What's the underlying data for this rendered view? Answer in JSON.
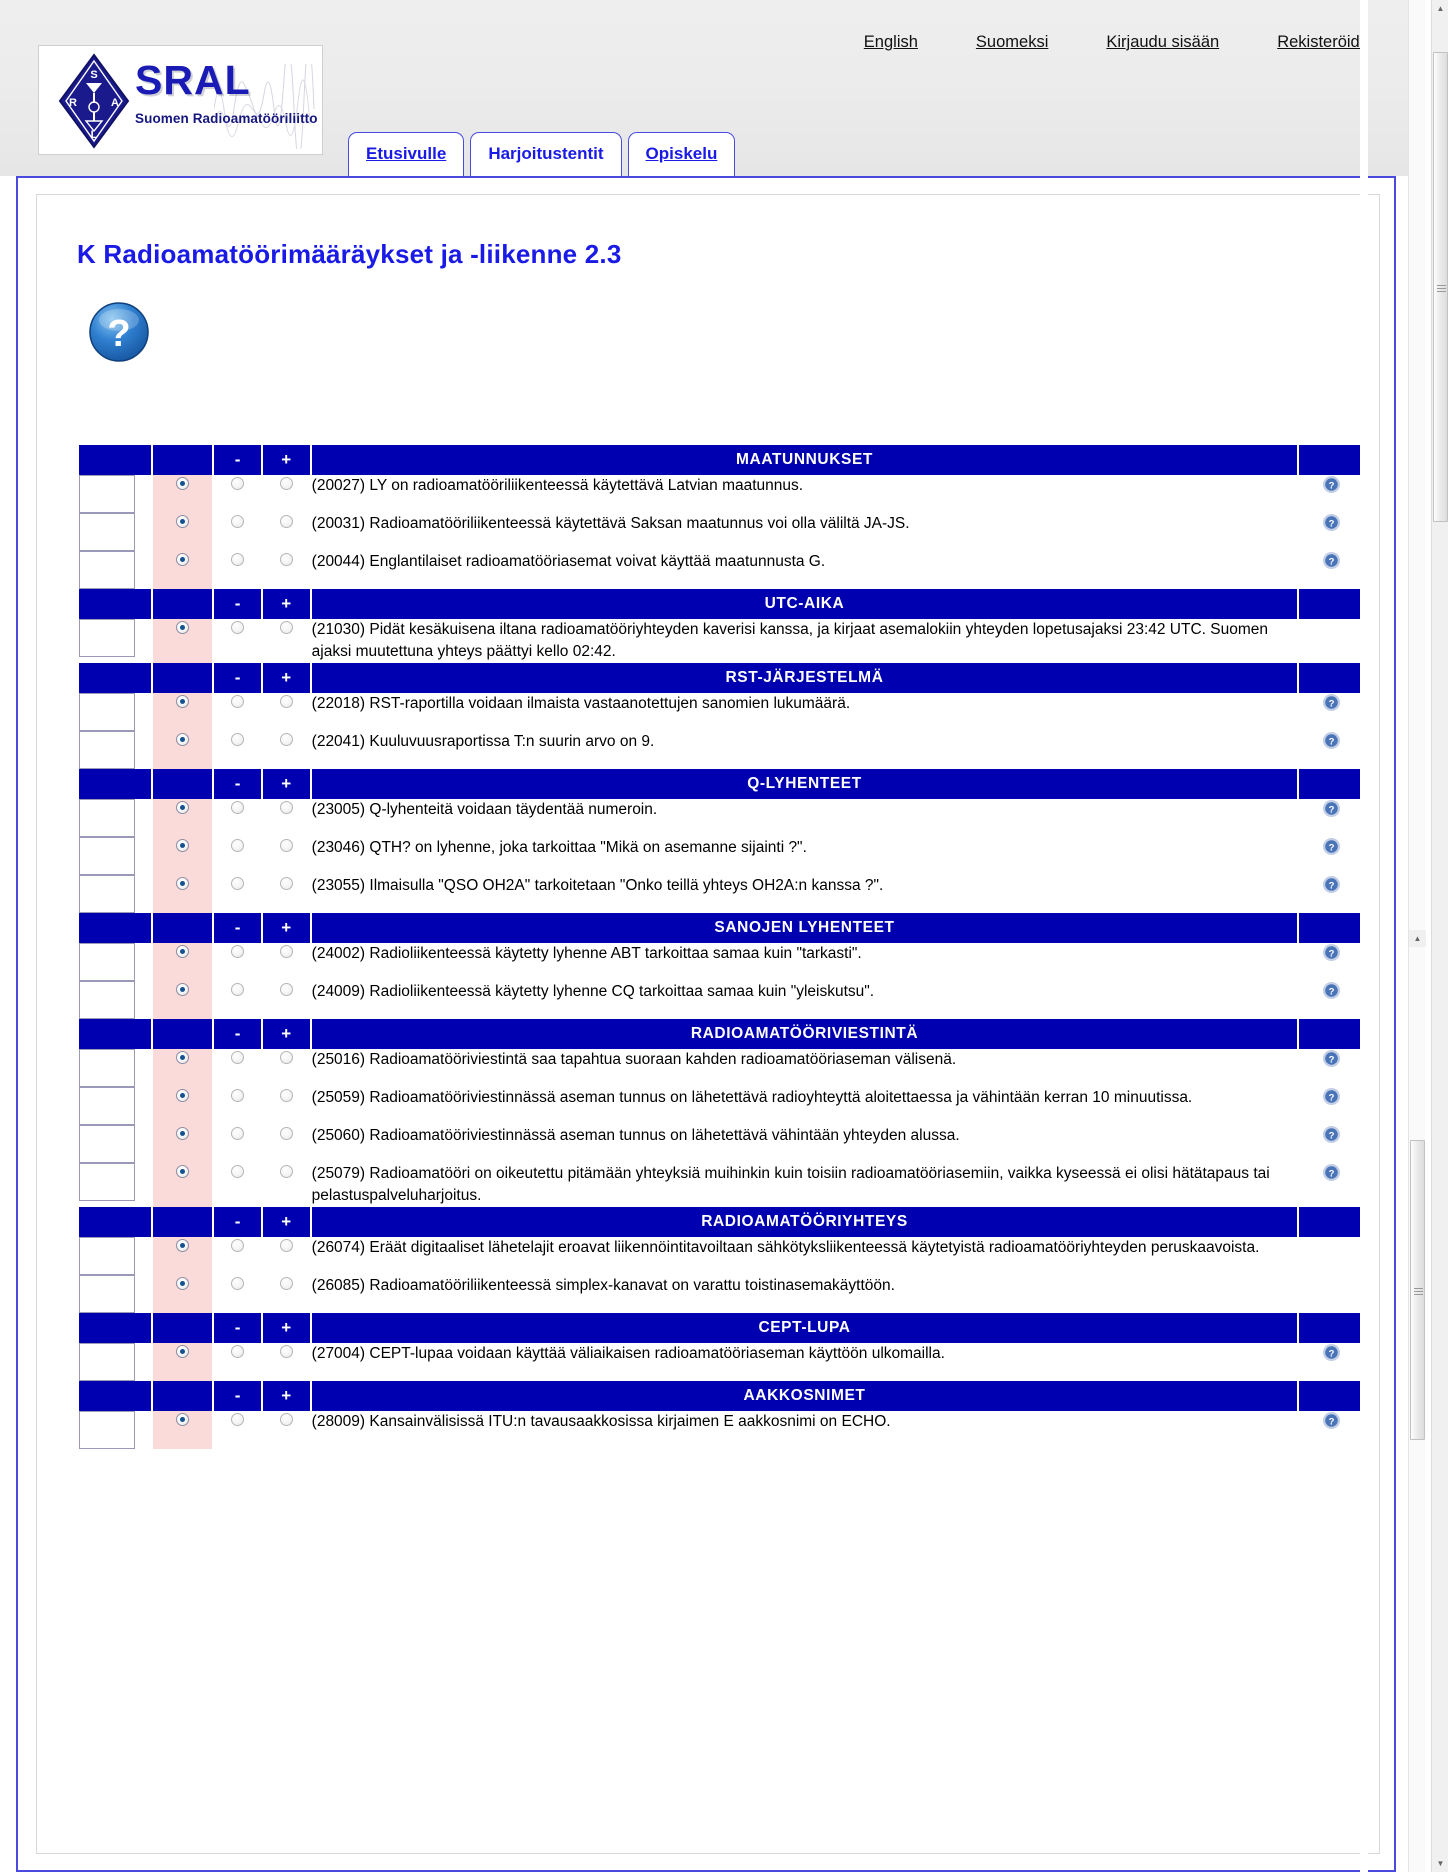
{
  "header": {
    "top_links": [
      {
        "label": "English",
        "name": "english-link"
      },
      {
        "label": "Suomeksi",
        "name": "suomeksi-link"
      },
      {
        "label": "Kirjaudu sisään",
        "name": "login-link"
      },
      {
        "label": "Rekisteröidy",
        "name": "register-link"
      }
    ],
    "logo": {
      "title": "SRAL",
      "subtitle": "Suomen Radioamatööriliitto ry",
      "diamond_letters": {
        "top": "S",
        "left": "R",
        "right": "A",
        "bottom": "L"
      }
    },
    "tabs": [
      {
        "label": "Etusivulle",
        "active": false
      },
      {
        "label": "Harjoitustentit",
        "active": true
      },
      {
        "label": "Opiskelu",
        "active": false
      }
    ]
  },
  "main": {
    "page_title": "K Radioamatöörimääräykset ja -liikenne 2.3",
    "help_icon": "question-mark-icon",
    "column_headers": {
      "minus": "-",
      "plus": "+"
    },
    "sections": [
      {
        "title": "MAATUNNUKSET",
        "questions": [
          {
            "text": "(20027) LY on radioamatööriliikenteessä käytettävä Latvian maatunnus.",
            "answer": "",
            "selected": 0,
            "help": true
          },
          {
            "text": "(20031) Radioamatööriliikenteessä käytettävä Saksan maatunnus voi olla väliltä JA-JS.",
            "answer": "",
            "selected": 0,
            "help": true
          },
          {
            "text": "(20044) Englantilaiset radioamatööriasemat voivat käyttää maatunnusta G.",
            "answer": "",
            "selected": 0,
            "help": true
          }
        ]
      },
      {
        "title": "UTC-AIKA",
        "questions": [
          {
            "text": "(21030) Pidät kesäkuisena iltana radioamatööriyhteyden kaverisi kanssa, ja kirjaat asemalokiin yhteyden lopetusajaksi 23:42 UTC. Suomen ajaksi muutettuna yhteys päättyi kello 02:42.",
            "answer": "",
            "selected": 0,
            "help": false
          }
        ]
      },
      {
        "title": "RST-JÄRJESTELMÄ",
        "questions": [
          {
            "text": "(22018) RST-raportilla voidaan ilmaista vastaanotettujen sanomien lukumäärä.",
            "answer": "",
            "selected": 0,
            "help": true
          },
          {
            "text": "(22041) Kuuluvuusraportissa T:n suurin arvo on 9.",
            "answer": "",
            "selected": 0,
            "help": true
          }
        ]
      },
      {
        "title": "Q-LYHENTEET",
        "questions": [
          {
            "text": "(23005) Q-lyhenteitä voidaan täydentää numeroin.",
            "answer": "",
            "selected": 0,
            "help": true
          },
          {
            "text": "(23046) QTH? on lyhenne, joka tarkoittaa \"Mikä on asemanne sijainti ?\".",
            "answer": "",
            "selected": 0,
            "help": true
          },
          {
            "text": "(23055) Ilmaisulla \"QSO OH2A\" tarkoitetaan \"Onko teillä yhteys OH2A:n kanssa ?\".",
            "answer": "",
            "selected": 0,
            "help": true
          }
        ]
      },
      {
        "title": "SANOJEN LYHENTEET",
        "questions": [
          {
            "text": "(24002) Radioliikenteessä käytetty lyhenne ABT tarkoittaa samaa kuin \"tarkasti\".",
            "answer": "",
            "selected": 0,
            "help": true
          },
          {
            "text": "(24009) Radioliikenteessä käytetty lyhenne CQ tarkoittaa samaa kuin \"yleiskutsu\".",
            "answer": "",
            "selected": 0,
            "help": true
          }
        ]
      },
      {
        "title": "RADIOAMATÖÖRIVIESTINTÄ",
        "questions": [
          {
            "text": "(25016) Radioamatööriviestintä saa tapahtua suoraan kahden radioamatööriaseman välisenä.",
            "answer": "",
            "selected": 0,
            "help": true
          },
          {
            "text": "(25059) Radioamatööriviestinnässä aseman tunnus on lähetettävä radioyhteyttä aloitettaessa ja vähintään kerran 10 minuutissa.",
            "answer": "",
            "selected": 0,
            "help": true
          },
          {
            "text": "(25060) Radioamatööriviestinnässä aseman tunnus on lähetettävä vähintään yhteyden alussa.",
            "answer": "",
            "selected": 0,
            "help": true
          },
          {
            "text": "(25079) Radioamatööri on oikeutettu pitämään yhteyksiä muihinkin kuin toisiin radioamatööriasemiin, vaikka kyseessä ei olisi hätätapaus tai pelastuspalveluharjoitus.",
            "answer": "",
            "selected": 0,
            "help": true
          }
        ]
      },
      {
        "title": "RADIOAMATÖÖRIYHTEYS",
        "questions": [
          {
            "text": "(26074) Eräät digitaaliset lähetelajit eroavat liikennöintitavoiltaan sähkötyksliikenteessä käytetyistä radioamatööriyhteyden peruskaavoista.",
            "answer": "",
            "selected": 0,
            "help": false
          },
          {
            "text": "(26085) Radioamatööriliikenteessä simplex-kanavat on varattu toistinasemakäyttöön.",
            "answer": "",
            "selected": 0,
            "help": false
          }
        ]
      },
      {
        "title": "CEPT-LUPA",
        "questions": [
          {
            "text": "(27004) CEPT-lupaa voidaan käyttää väliaikaisen radioamatööriaseman käyttöön ulkomailla.",
            "answer": "",
            "selected": 0,
            "help": true
          }
        ]
      },
      {
        "title": "AAKKOSNIMET",
        "questions": [
          {
            "text": "(28009) Kansainvälisissä ITU:n tavausaakkosissa kirjaimen E aakkosnimi on ECHO.",
            "answer": "",
            "selected": 0,
            "help": true
          }
        ]
      }
    ]
  },
  "colors": {
    "section_blue": "#0000b0",
    "link_blue": "#1a1ae6",
    "selected_pink": "#fbdada",
    "border_blue": "#4a4ae0"
  }
}
